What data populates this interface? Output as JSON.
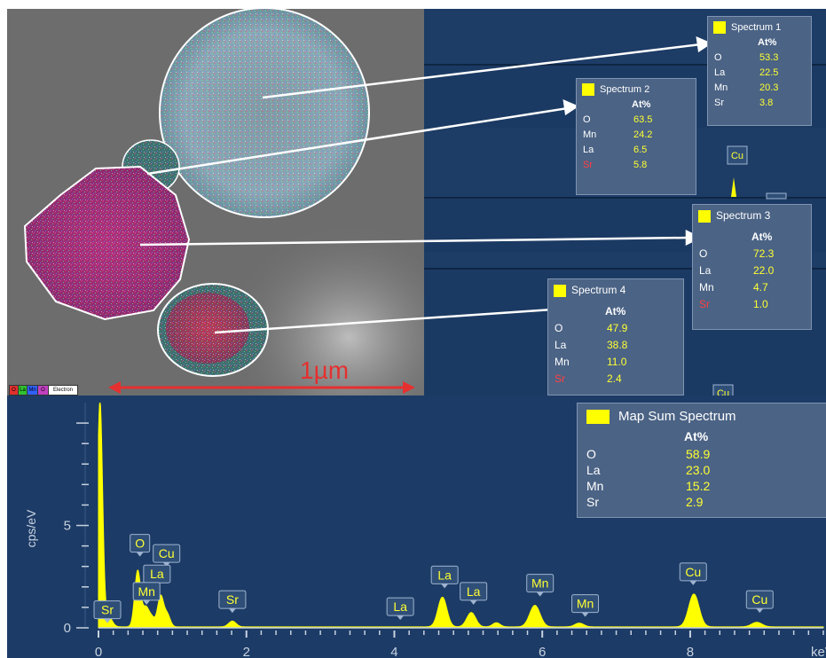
{
  "sem_image": {
    "scale_bar_label": "1µm",
    "legend_chips": [
      {
        "label": "O",
        "color": "#e03030"
      },
      {
        "label": "La",
        "color": "#30c030"
      },
      {
        "label": "Mn",
        "color": "#3060ff"
      },
      {
        "label": "O",
        "color": "#c040c0"
      },
      {
        "label": "Electron",
        "color": "#ffffff"
      }
    ]
  },
  "spectrum_boxes": [
    {
      "title": "Spectrum 1",
      "header": "At%",
      "rows": [
        {
          "el": "O",
          "val": "53.3",
          "red": false
        },
        {
          "el": "La",
          "val": "22.5",
          "red": false
        },
        {
          "el": "Mn",
          "val": "20.3",
          "red": false
        },
        {
          "el": "Sr",
          "val": "3.8",
          "red": false
        }
      ]
    },
    {
      "title": "Spectrum 2",
      "header": "At%",
      "rows": [
        {
          "el": "O",
          "val": "63.5",
          "red": false
        },
        {
          "el": "Mn",
          "val": "24.2",
          "red": false
        },
        {
          "el": "La",
          "val": "6.5",
          "red": false
        },
        {
          "el": "Sr",
          "val": "5.8",
          "red": true
        }
      ]
    },
    {
      "title": "Spectrum 3",
      "header": "At%",
      "rows": [
        {
          "el": "O",
          "val": "72.3",
          "red": false
        },
        {
          "el": "La",
          "val": "22.0",
          "red": false
        },
        {
          "el": "Mn",
          "val": "4.7",
          "red": false
        },
        {
          "el": "Sr",
          "val": "1.0",
          "red": true
        }
      ]
    },
    {
      "title": "Spectrum 4",
      "header": "At%",
      "rows": [
        {
          "el": "O",
          "val": "47.9",
          "red": false
        },
        {
          "el": "La",
          "val": "38.8",
          "red": false
        },
        {
          "el": "Mn",
          "val": "11.0",
          "red": false
        },
        {
          "el": "Sr",
          "val": "2.4",
          "red": true
        }
      ]
    }
  ],
  "upper_peak_labels": [
    "Cu",
    "Cu"
  ],
  "map_sum": {
    "title": "Map Sum Spectrum",
    "header": "At%",
    "rows": [
      {
        "el": "O",
        "val": "58.9"
      },
      {
        "el": "La",
        "val": "23.0"
      },
      {
        "el": "Mn",
        "val": "15.2"
      },
      {
        "el": "Sr",
        "val": "2.9"
      }
    ]
  },
  "chart_data": {
    "type": "line",
    "xlabel": "keV",
    "ylabel": "cps/eV",
    "xlim": [
      0,
      9.8
    ],
    "ylim": [
      0,
      11
    ],
    "x_ticks": [
      0,
      2,
      4,
      6,
      8
    ],
    "y_ticks": [
      0,
      5
    ],
    "grid": false,
    "series_color": "#ffff00",
    "peaks": [
      {
        "x": 0.02,
        "y": 11.0,
        "w": 0.035
      },
      {
        "x": 0.13,
        "y": 0.55,
        "w": 0.05
      },
      {
        "x": 0.53,
        "y": 2.75,
        "w": 0.04
      },
      {
        "x": 0.64,
        "y": 0.9,
        "w": 0.04
      },
      {
        "x": 0.72,
        "y": 0.45,
        "w": 0.04
      },
      {
        "x": 0.84,
        "y": 1.5,
        "w": 0.04
      },
      {
        "x": 0.93,
        "y": 0.6,
        "w": 0.04
      },
      {
        "x": 1.81,
        "y": 0.28,
        "w": 0.05
      },
      {
        "x": 4.65,
        "y": 1.45,
        "w": 0.06
      },
      {
        "x": 5.04,
        "y": 0.7,
        "w": 0.06
      },
      {
        "x": 5.38,
        "y": 0.2,
        "w": 0.05
      },
      {
        "x": 5.9,
        "y": 1.05,
        "w": 0.07
      },
      {
        "x": 6.5,
        "y": 0.18,
        "w": 0.06
      },
      {
        "x": 8.05,
        "y": 1.6,
        "w": 0.07
      },
      {
        "x": 8.9,
        "y": 0.22,
        "w": 0.07
      }
    ],
    "peak_labels": [
      {
        "label": "Sr",
        "x": 0.12,
        "y": 0.45
      },
      {
        "label": "O",
        "x": 0.56,
        "y": 3.7
      },
      {
        "label": "Cu",
        "x": 0.92,
        "y": 3.2
      },
      {
        "label": "La",
        "x": 0.79,
        "y": 2.2
      },
      {
        "label": "Mn",
        "x": 0.65,
        "y": 1.35
      },
      {
        "label": "Sr",
        "x": 1.81,
        "y": 0.95
      },
      {
        "label": "La",
        "x": 4.08,
        "y": 0.6
      },
      {
        "label": "La",
        "x": 4.68,
        "y": 2.15
      },
      {
        "label": "La",
        "x": 5.07,
        "y": 1.35
      },
      {
        "label": "Mn",
        "x": 5.97,
        "y": 1.75
      },
      {
        "label": "Mn",
        "x": 6.58,
        "y": 0.75
      },
      {
        "label": "Cu",
        "x": 8.04,
        "y": 2.3
      },
      {
        "label": "Cu",
        "x": 8.94,
        "y": 0.95
      }
    ]
  }
}
